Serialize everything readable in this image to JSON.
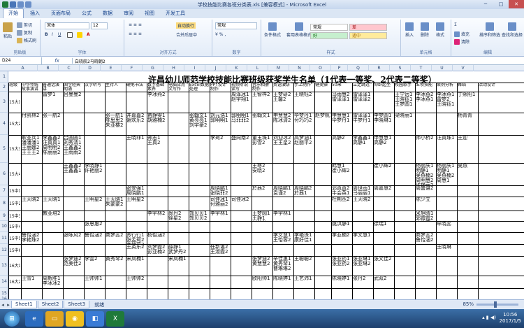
{
  "window": {
    "title": "学校技能比赛各班分类表.xls  [兼容模式] - Microsoft Excel",
    "min": "─",
    "max": "□",
    "close": "✕"
  },
  "ribbon_tabs": [
    "开始",
    "插入",
    "页面布局",
    "公式",
    "数据",
    "审阅",
    "视图",
    "开发工具"
  ],
  "clipboard": {
    "cut": "剪切",
    "copy": "复制",
    "paste": "粘贴",
    "format_painter": "格式刷",
    "label": "剪贴板"
  },
  "font": {
    "name": "宋体",
    "size": "12",
    "label": "字体"
  },
  "alignment": {
    "wrap": "自动换行",
    "merge": "合并后居中",
    "label": "对齐方式"
  },
  "number": {
    "format": "常规",
    "label": "数字"
  },
  "styles": {
    "cond_format": "条件格式",
    "table_format": "套用表格格式",
    "normal": "常规",
    "bad": "差",
    "good": "好",
    "neutral": "适中",
    "label": "样式"
  },
  "cells": {
    "insert": "插入",
    "delete": "删除",
    "format": "格式",
    "label": "单元格"
  },
  "editing": {
    "fill": "填充",
    "clear": "清除",
    "sort": "排序和筛选",
    "find": "查找和选择",
    "label": "编辑"
  },
  "formula": {
    "cell_ref": "D24",
    "fx": "fx",
    "value": "白晓航2马晓朝2"
  },
  "columns": [
    "A",
    "B",
    "C",
    "D",
    "E",
    "F",
    "G",
    "H",
    "I",
    "J",
    "K",
    "L",
    "M",
    "N",
    "O",
    "P",
    "Q",
    "R",
    "S",
    "T",
    "U",
    "V"
  ],
  "rows": [
    "1",
    "2",
    "3",
    "4",
    "5",
    "6",
    "7",
    "8",
    "9",
    "10",
    "11",
    "12",
    "13",
    "14",
    "15",
    "16"
  ],
  "sheet": {
    "title": "许昌幼儿师范学校技能比赛班级获奖学生名单（1代表一等奖、2代表二等奖）",
    "headers": [
      "班级",
      "中华传统故事演讲",
      "普通话演讲",
      "国学经典朗诵",
      "汉字听写",
      "主持人",
      "硬笔书法",
      "数字基础素养",
      "电脑应用文写作",
      "Excel数据处理",
      "PPT设计制作",
      "视频听说读写",
      "音乐相册制作",
      "英语演讲",
      "手工制作",
      "健美操",
      "50米",
      "立定跳远",
      "仰卧起坐",
      "校园歌手",
      "五项技能",
      "案例分析",
      "舞蹈",
      "活动设计"
    ],
    "rows": [
      {
        "c0": "15大1",
        "c2": "雷梦1",
        "c3": "吕曼曼2",
        "c7": "李冰燕2",
        "c11": "周泽冰1\n赵宇翔1",
        "c12": "王智梓2",
        "c13": "王梦研2\n王馨2",
        "c14": "王晓钰2",
        "c16": "冯雨慧2\n雷泽泽1",
        "c17": "雷泽泽1\n雷泽泽2",
        "c19": "王宁远1\n王晓钰1\n王梦圆1",
        "c20": "李冰燕2\n李冰燕1",
        "c21": "李冰燕1\n雷梦2\n王晓钰1",
        "c22": "丁熙阳1"
      },
      {
        "c0": "15大2",
        "c1": "付凯林2",
        "c2": "张一航2",
        "c5": "张一航1\n陈思思2\n朱亚楼2",
        "c6": "井嘉嘉2\n谢欢乐2",
        "c7": "苗静雯1\n胡雅楠2",
        "c9": "张翰文1\n黄亮亮1\n刘宇豪2",
        "c10": "刘元浩1\n郭明明1",
        "c11": "郭明明1\n马菲菲2",
        "c12": "张翰文1",
        "c13": "申慧慧2\n陈冰清2",
        "c14": "华梦丹1\n付巧巧2",
        "c15": "赵梦帆2",
        "c16": "申慧慧1\n华梦丹1",
        "c17": "雷泽泽1\n牛梦丹1",
        "c18": "李梦圆1\n李晓琳1",
        "c19": "梁晓丽1",
        "c22": "杨青青"
      },
      {
        "c0": "15大3",
        "c1": "耿亚兵1\n潘潘潘1\n王丽娜2\n王王王2",
        "c2": "李鑫鑫2\n汪真真1\n周明明2\n陈丽丽2",
        "c3": "吕圆圆1\n刘秀清1\n王鑫鑫2\n王雨雨2",
        "c6": "王晓菲1",
        "c7": "郑志1\n王真2",
        "c10": "李珂2",
        "c11": "盛向南2",
        "c12": "董玉珠1\n彭雪2",
        "c13": "刘迎冰2\n王王星2",
        "c14": "高梦涵1\n赵丽平2",
        "c16": "高静2",
        "c17": "李鑫鑫1\n高静1",
        "c18": "申慧慧1\n高静2",
        "c20": "师小桥2",
        "c21": "汪真珠1",
        "c22": "王迎"
      },
      {
        "c0": "15大4",
        "c3": "王鑫鑫2\n王鑫鑫1",
        "c4": "李晓静1\n许艳丽2",
        "c12": "王寒2\n安晓2",
        "c16": "韩慧1\n崔小辉2",
        "c18": "崔小辉2",
        "c20": "杨丽庆1\n明静1\n吴燕楠2\n周明慧2\n许艳丽2",
        "c21": "杨丽庆1\n明静1\n吴燕楠2\n周慧1",
        "c22": "吴燕"
      },
      {
        "c0": "15中1",
        "c6": "张安强1\n周晓鹏1",
        "c10": "周晓鹏1\n张晓菲2",
        "c12": "於茜2",
        "c13": "周晓鹏1\n袁谨2",
        "c14": "周晓鹏2\n於茜1",
        "c16": "郭真真2\n牛会英1",
        "c17": "周世雨1\n马丽丽1",
        "c18": "周嘉慧2",
        "c20": "周盛谌2"
      },
      {
        "c0": "15中2",
        "c1": "王天晓2",
        "c2": "王天晓1",
        "c4": "王明星2",
        "c5": "王天晓1\n朱蒙蒙2",
        "c6": "王明星2",
        "c10": "司佳冰1\n付雅丽2",
        "c11": "司佳冰2",
        "c16": "杜荆丛2",
        "c17": "王天晓2",
        "c20": "陈少立"
      },
      {
        "c0": "15中3",
        "c2": "教亚培2",
        "c7": "李宇林2",
        "c8": "尚丹2\n徐星2",
        "c9": "郑贝贝1\n郑贝贝2",
        "c10": "李宇林1",
        "c12": "王梦圆1\n王静1\n刘欣欣2",
        "c13": "李宇林1",
        "c20": "米旭晴1\n郭霞霞2\n李佳蕊2"
      },
      {
        "c0": "15中4",
        "c4": "张恩惠2",
        "c16": "姚洪静1",
        "c18": "徐瑞1",
        "c21": "牟晓蕊"
      },
      {
        "c0": "15中5",
        "c1": "鲁怡涵2\n李艳珠2",
        "c3": "张咏风2",
        "c4": "鲁怡涵2",
        "c5": "商梦蕊2",
        "c6": "苏行行1\n张孟珂2\n商梦蕊2",
        "c7": "杨怡涵2",
        "c13": "李文慧1\n王怡蓉2",
        "c14": "李艳珠1\n康好佳1",
        "c16": "李亚楠2",
        "c17": "李文慧1",
        "c20": "商梦蕊2\n鲁怡涵2"
      },
      {
        "c0": "15中6",
        "c6": "王英乐2",
        "c7": "刘梦霞2\n彭亚楠2",
        "c8": "薛静1\n武梦丹2",
        "c10": "任新谌2\n王淑霞2",
        "c21": "王晓琳"
      },
      {
        "c0": "16大1",
        "c3": "张梦迪2\n范美佳2",
        "c4": "李雲2",
        "c5": "黄秀琴2",
        "c6": "宋凤楠1",
        "c8": "宋凤楠1",
        "c12": "张梦迪2\n黄慧慧2",
        "c13": "辛佳惠1\n黄秀琴1\n曹琳琳2",
        "c14": "王聪聪2",
        "c16": "张亚药1\n张亚药2",
        "c17": "张亚琳1\n张亚琳2",
        "c18": "张文佳2"
      },
      {
        "c0": "16大2",
        "c1": "王雪1",
        "c2": "周新胜1\n李冰冰2",
        "c4": "王帅帅1",
        "c6": "王帅帅2",
        "c12": "欧阳帅1",
        "c13": "陈晓婷1",
        "c14": "王艺沛1",
        "c16": "陈晓婷1",
        "c17": "张丹2",
        "c18": "武双2"
      }
    ]
  },
  "sheet_tabs": [
    "Sheet1",
    "Sheet2",
    "Sheet3"
  ],
  "status": {
    "mode": "就绪",
    "zoom": "85%"
  },
  "taskbar": {
    "time": "10:56",
    "date": "2017/1/5"
  }
}
